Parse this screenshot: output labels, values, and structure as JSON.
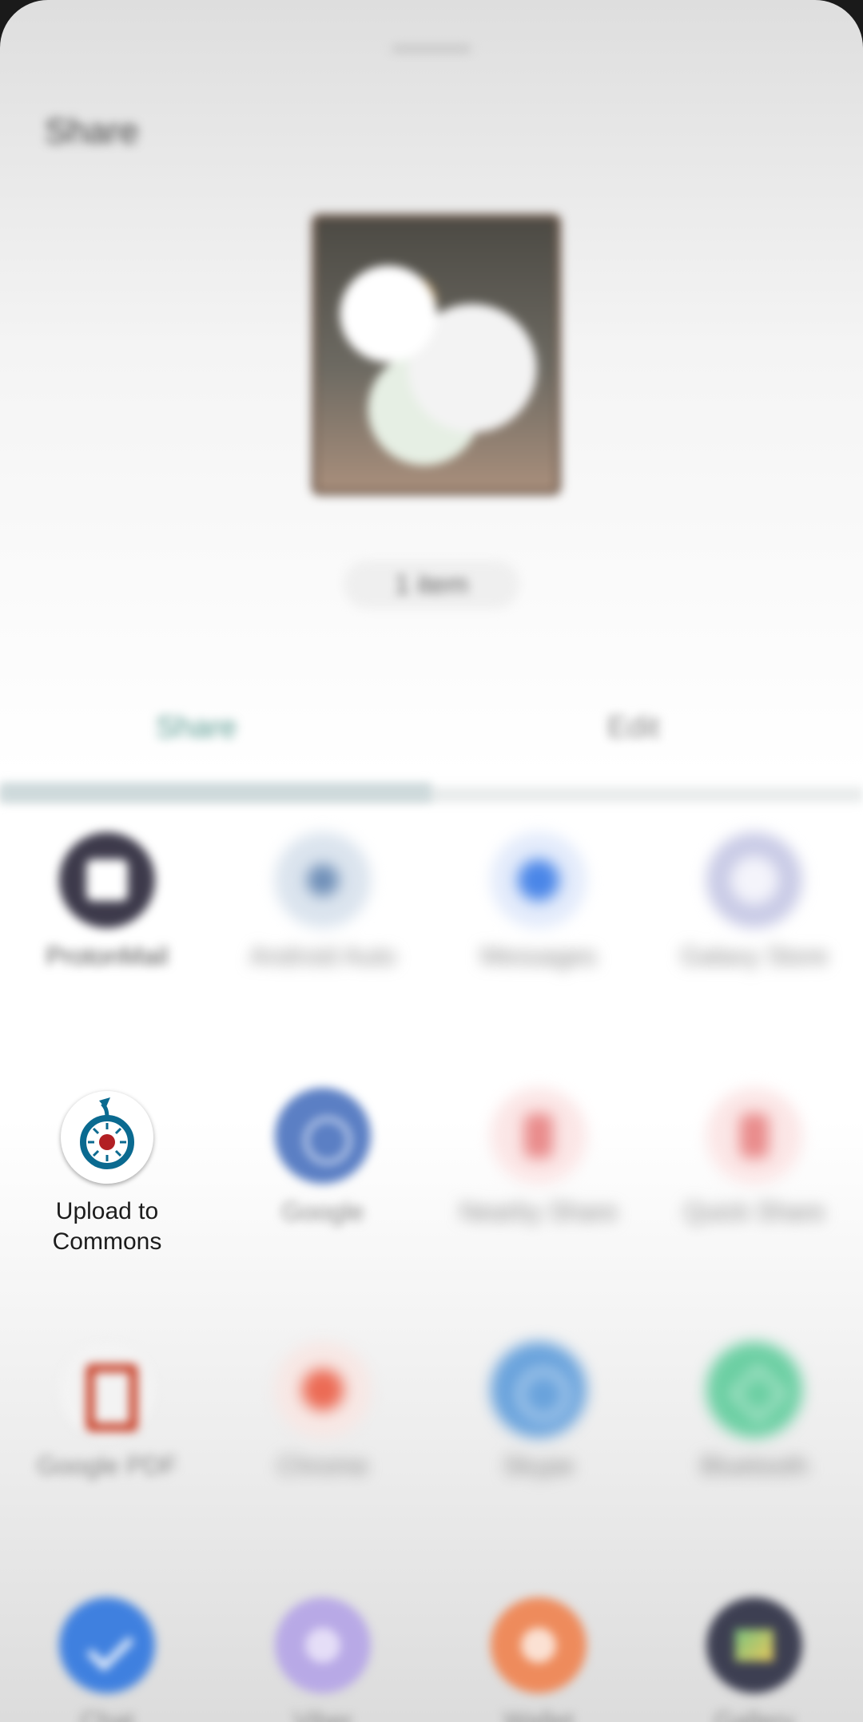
{
  "sheet": {
    "title": "Share",
    "preview_caption": "1 item"
  },
  "tabs": [
    {
      "label": "Share"
    },
    {
      "label": "Edit"
    }
  ],
  "apps": [
    {
      "label": "ProtonMail",
      "color": "#3d3a4b"
    },
    {
      "label": "Android Auto",
      "color": "#9cb4cc"
    },
    {
      "label": "Messages",
      "color": "#4a86e8"
    },
    {
      "label": "Galaxy Store",
      "color": "#c9cbe6"
    },
    {
      "label": "Upload to Commons",
      "color": "#ffffff"
    },
    {
      "label": "Google",
      "color": "#5b7fc4"
    },
    {
      "label": "Nearby Share",
      "color": "#f1b5b5"
    },
    {
      "label": "Quick Share",
      "color": "#f1b5b5"
    },
    {
      "label": "Google PDF",
      "color": "#f3f3f3"
    },
    {
      "label": "Chrome",
      "color": "#ec6b55"
    },
    {
      "label": "Skype",
      "color": "#6aa3dc"
    },
    {
      "label": "Bluetooth",
      "color": "#6ccfa3"
    },
    {
      "label": "Chat",
      "color": "#3f80df"
    },
    {
      "label": "Viber",
      "color": "#b8a9e6"
    },
    {
      "label": "Wallet",
      "color": "#ee8b5c"
    },
    {
      "label": "Gallery",
      "color": "#3d3f52"
    }
  ]
}
